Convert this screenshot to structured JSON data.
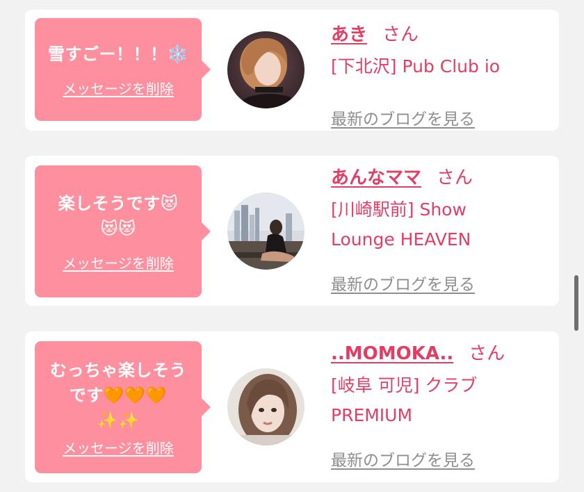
{
  "cards": [
    {
      "message_lines": [
        "雪すごー！！！❄️"
      ],
      "delete_label": "メッセージを削除",
      "name": "あき",
      "honorific": "さん",
      "shop_lines": [
        "[下北沢] Pub Club io"
      ],
      "blog_label": "最新のブログを見る"
    },
    {
      "message_lines": [
        "楽しそうです😻",
        "😻😻"
      ],
      "delete_label": "メッセージを削除",
      "name": "あんなママ",
      "honorific": "さん",
      "shop_lines": [
        "[川崎駅前] Show",
        "Lounge HEAVEN"
      ],
      "blog_label": "最新のブログを見る"
    },
    {
      "message_lines": [
        "むっちゃ楽しそう",
        "です🧡🧡🧡",
        "✨✨"
      ],
      "delete_label": "メッセージを削除",
      "name": "..MOMOKA..",
      "honorific": "さん",
      "shop_lines": [
        "[岐阜 可児] クラブ",
        "PREMIUM"
      ],
      "blog_label": "最新のブログを見る"
    }
  ],
  "colors": {
    "accent": "#e33d63",
    "bubble": "#fd8f9e",
    "muted": "#8e8e8e",
    "background": "#f2f2f2"
  }
}
